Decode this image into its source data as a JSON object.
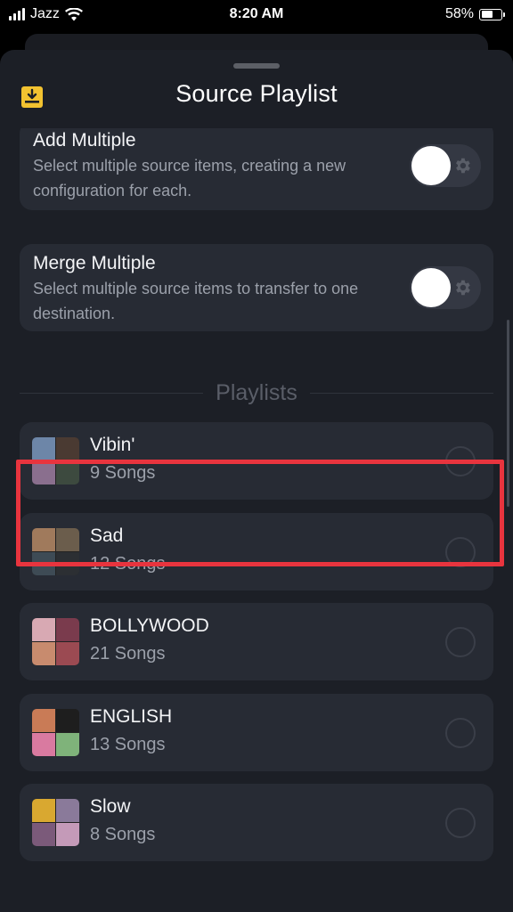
{
  "status_bar": {
    "carrier": "Jazz",
    "time": "8:20 AM",
    "battery_percent": "58%",
    "battery_level": 0.58
  },
  "sheet": {
    "title": "Source Playlist",
    "header_icon": "download-icon"
  },
  "options": [
    {
      "title": "Add Multiple",
      "description": "Select multiple source items, creating a new configuration for each.",
      "enabled": false
    },
    {
      "title": "Merge Multiple",
      "description": "Select multiple source items to transfer to one destination.",
      "enabled": false
    }
  ],
  "section_label": "Playlists",
  "playlists": [
    {
      "name": "Vibin'",
      "count": "9 Songs",
      "cover_colors": [
        "#6d86a8",
        "#4a3a32",
        "#8a6f8e",
        "#3d4a3f"
      ],
      "selected": false
    },
    {
      "name": "Sad",
      "count": "12 Songs",
      "cover_colors": [
        "#a07a5c",
        "#6b5d4c",
        "#3e4b55",
        "#2c2f33"
      ],
      "selected": false
    },
    {
      "name": "BOLLYWOOD",
      "count": "21 Songs",
      "cover_colors": [
        "#d8a9b3",
        "#7a3b4d",
        "#c88b6e",
        "#9b4a52"
      ],
      "selected": false
    },
    {
      "name": "ENGLISH",
      "count": "13 Songs",
      "cover_colors": [
        "#c97b56",
        "#1e1e1e",
        "#d97aa0",
        "#7fb37a"
      ],
      "selected": false
    },
    {
      "name": "Slow",
      "count": "8 Songs",
      "cover_colors": [
        "#d9a830",
        "#8a7a9a",
        "#7b5a7a",
        "#c49ab8"
      ],
      "selected": false
    }
  ],
  "colors": {
    "accent": "#f2c230",
    "highlight": "#e8343e",
    "card": "#272b34",
    "sheet": "#1c1f26"
  }
}
